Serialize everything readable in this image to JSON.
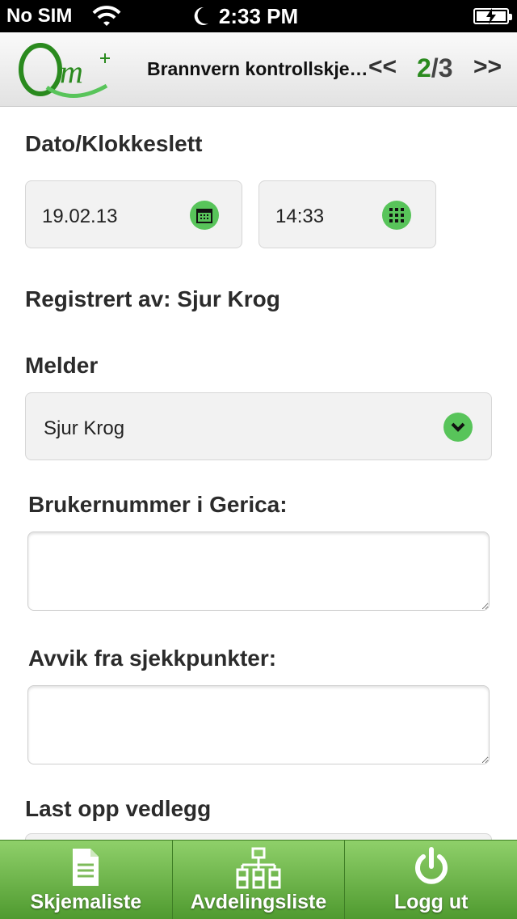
{
  "status": {
    "carrier": "No SIM",
    "time": "2:33 PM"
  },
  "header": {
    "title": "Brannvern kontrollskjema",
    "prev_label": "<<",
    "page_current": "2",
    "page_total": "/3",
    "next_label": ">>",
    "logo_colors": [
      "#2a8a1e",
      "#58c45a"
    ]
  },
  "form": {
    "datetime_label": "Dato/Klokkeslett",
    "date_value": "19.02.13",
    "time_value": "14:33",
    "registered_by": "Registrert av: Sjur Krog",
    "melder_label": "Melder",
    "melder_value": "Sjur Krog",
    "brukernummer_label": "Brukernummer i Gerica:",
    "brukernummer_value": "",
    "avvik_label": "Avvik fra sjekkpunkter:",
    "avvik_value": "",
    "attachment_label": "Last opp vedlegg"
  },
  "tabs": [
    {
      "label": "Skjemaliste",
      "icon": "document-icon"
    },
    {
      "label": "Avdelingsliste",
      "icon": "org-chart-icon"
    },
    {
      "label": "Logg ut",
      "icon": "power-icon"
    }
  ],
  "colors": {
    "accent_green": "#58c45a",
    "tab_bar_top": "#8fd06a",
    "tab_bar_bottom": "#4f9a2f"
  }
}
